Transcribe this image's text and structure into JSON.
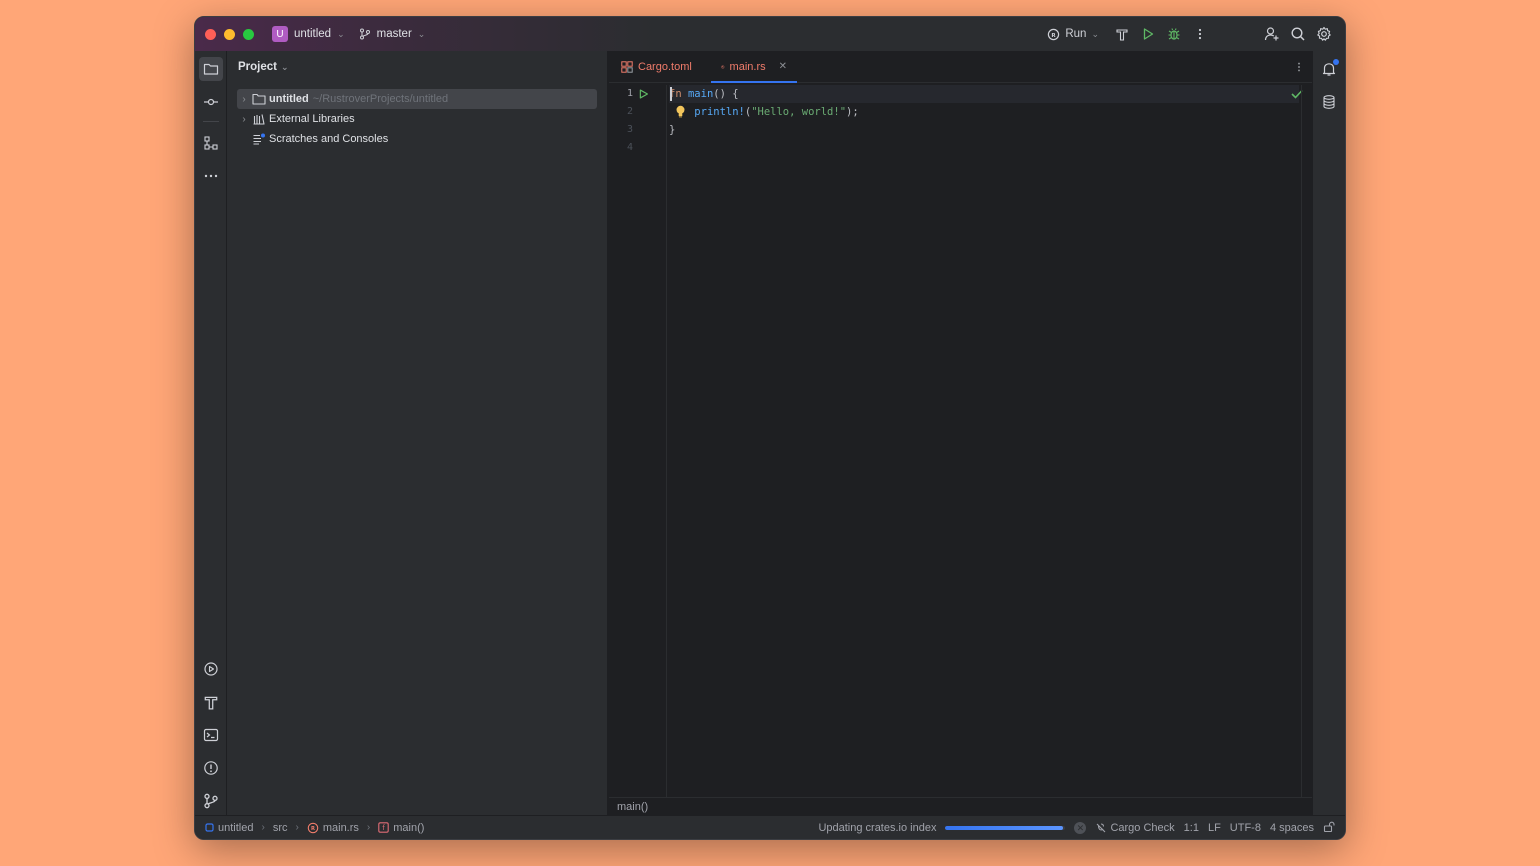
{
  "titlebar": {
    "project_badge": "U",
    "project_name": "untitled",
    "branch": "master",
    "run_config": "Run"
  },
  "project_panel": {
    "title": "Project",
    "tree": [
      {
        "label": "untitled",
        "path": "~/RustroverProjects/untitled",
        "expandable": true,
        "selected": true
      },
      {
        "label": "External Libraries",
        "expandable": true
      },
      {
        "label": "Scratches and Consoles",
        "expandable": false
      }
    ]
  },
  "editor": {
    "tabs": [
      {
        "label": "Cargo.toml",
        "active": false
      },
      {
        "label": "main.rs",
        "active": true
      }
    ],
    "line_numbers": [
      "1",
      "2",
      "3",
      "4"
    ],
    "code": {
      "l1_kw": "fn",
      "l1_name": "main",
      "l1_rest": "() {",
      "l2_indent": "    ",
      "l2_macro": "println!",
      "l2_open": "(",
      "l2_str": "\"Hello, world!\"",
      "l2_close": ");",
      "l3": "}"
    },
    "breadcrumb": "main()"
  },
  "statusbar": {
    "crumbs": [
      "untitled",
      "src",
      "main.rs",
      "main()"
    ],
    "task": "Updating crates.io index",
    "progress": 0.98,
    "cargo_check": "Cargo Check",
    "position": "1:1",
    "line_sep": "LF",
    "encoding": "UTF-8",
    "indent": "4 spaces"
  },
  "colors": {
    "accent": "#3574F0",
    "background": "#FFA677",
    "editor_bg": "#1E1F22",
    "panel_bg": "#2B2D30",
    "keyword": "#CF8E6D",
    "function": "#56A8F5",
    "string": "#6AAB73",
    "rust_file": "#F07C6B"
  }
}
